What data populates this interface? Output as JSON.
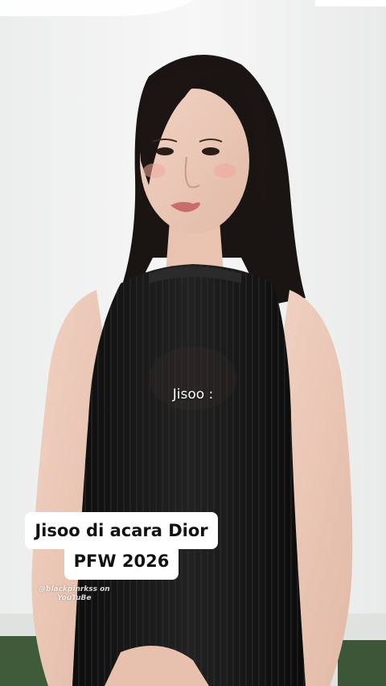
{
  "overlay": {
    "speaker_label": "Jisoo :",
    "caption_line_1": "Jisoo di acara Dior",
    "caption_line_2": "PFW 2026"
  },
  "watermark": {
    "line_1": "@blackpinrkss on",
    "line_2": "YouTuBe"
  },
  "colors": {
    "background": "#f3f4f4",
    "dress": "#141414",
    "caption_bg": "#ffffff",
    "caption_text": "#111111"
  }
}
